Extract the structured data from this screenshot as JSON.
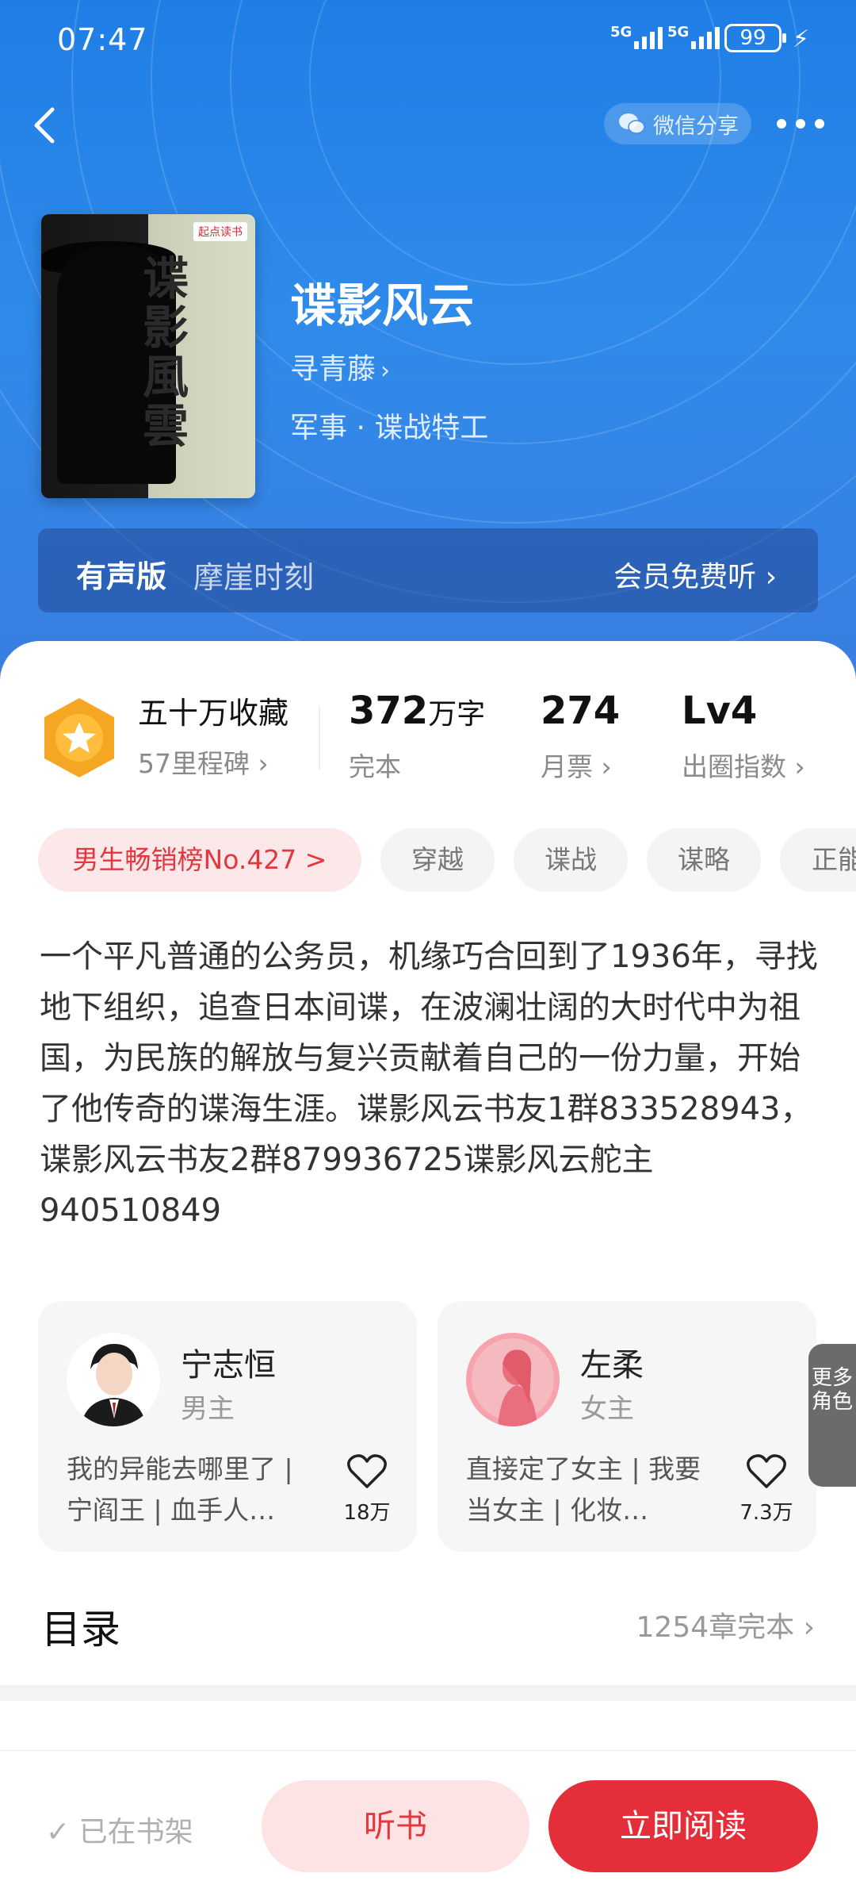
{
  "status_bar": {
    "time": "07:47",
    "network1": "5G",
    "network2": "5G",
    "battery": "99"
  },
  "header": {
    "share_label": "微信分享"
  },
  "book": {
    "cover_badge": "起点读书",
    "cover_title": "谍影風雲",
    "title": "谍影风云",
    "author": "寻青藤",
    "genre": "军事 · 谍战特工"
  },
  "audio": {
    "label": "有声版",
    "narrator": "摩崖时刻",
    "action": "会员免费听"
  },
  "stats": {
    "collect_main": "五十万收藏",
    "collect_sub": "57里程碑",
    "words_num": "372",
    "words_unit": "万字",
    "words_label": "完本",
    "tickets_num": "274",
    "tickets_label": "月票",
    "index_num": "Lv4",
    "index_label": "出圈指数"
  },
  "tags": [
    "男生畅销榜No.427 >",
    "穿越",
    "谍战",
    "谋略",
    "正能"
  ],
  "intro": "一个平凡普通的公务员，机缘巧合回到了1936年，寻找地下组织，追查日本间谍，在波澜壮阔的大时代中为祖国，为民族的解放与复兴贡献着自己的一份力量，开始了他传奇的谍海生涯。谍影风云书友1群833528943，谍影风云书友2群879936725谍影风云舵主940510849",
  "roles": [
    {
      "name": "宁志恒",
      "role": "男主",
      "desc": "我的异能去哪里了 | 宁阎王 | 血手人…",
      "likes": "18万"
    },
    {
      "name": "左柔",
      "role": "女主",
      "desc": "直接定了女主 | 我要当女主 | 化妆…",
      "likes": "7.3万"
    }
  ],
  "more_roles": "更多角色",
  "toc": {
    "title": "目录",
    "info": "1254章完本"
  },
  "bottom": {
    "shelf": "✓ 已在书架",
    "listen": "听书",
    "read": "立即阅读"
  },
  "colors": {
    "accent": "#e42f3a",
    "header_blue": "#2f8bea",
    "medal": "#f5a623"
  }
}
